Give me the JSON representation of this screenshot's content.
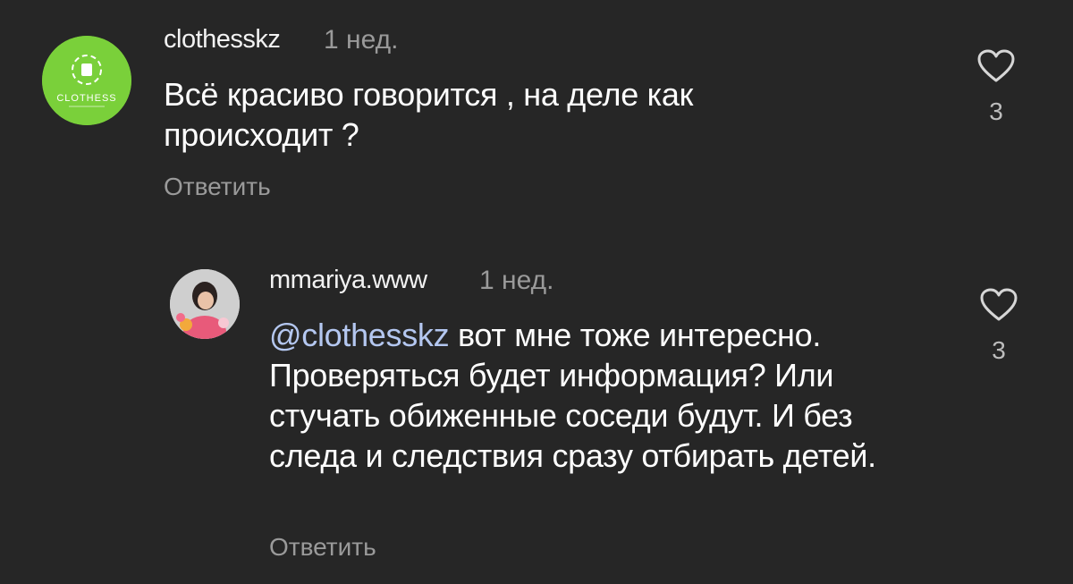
{
  "comments": [
    {
      "username": "clothesskz",
      "time": "1 нед.",
      "text": "Всё красиво говорится , на деле как происходит ?",
      "reply_label": "Ответить",
      "likes": "3",
      "avatar_text": "CLOTHESS"
    },
    {
      "username": "mmariya.www",
      "time": "1 нед.",
      "mention": "@clothesskz",
      "text": " вот мне тоже интересно. Проверяться будет информация? Или стучать обиженные соседи будут. И без следа и следствия сразу отбирать детей.",
      "reply_label": "Ответить",
      "likes": "3"
    }
  ],
  "colors": {
    "background": "#262626",
    "brand_green": "#7ad03a",
    "mention": "#b4c7f0",
    "secondary_text": "#9a9a9a"
  },
  "icons": [
    "heart-outline-icon",
    "brand-logo-icon"
  ]
}
